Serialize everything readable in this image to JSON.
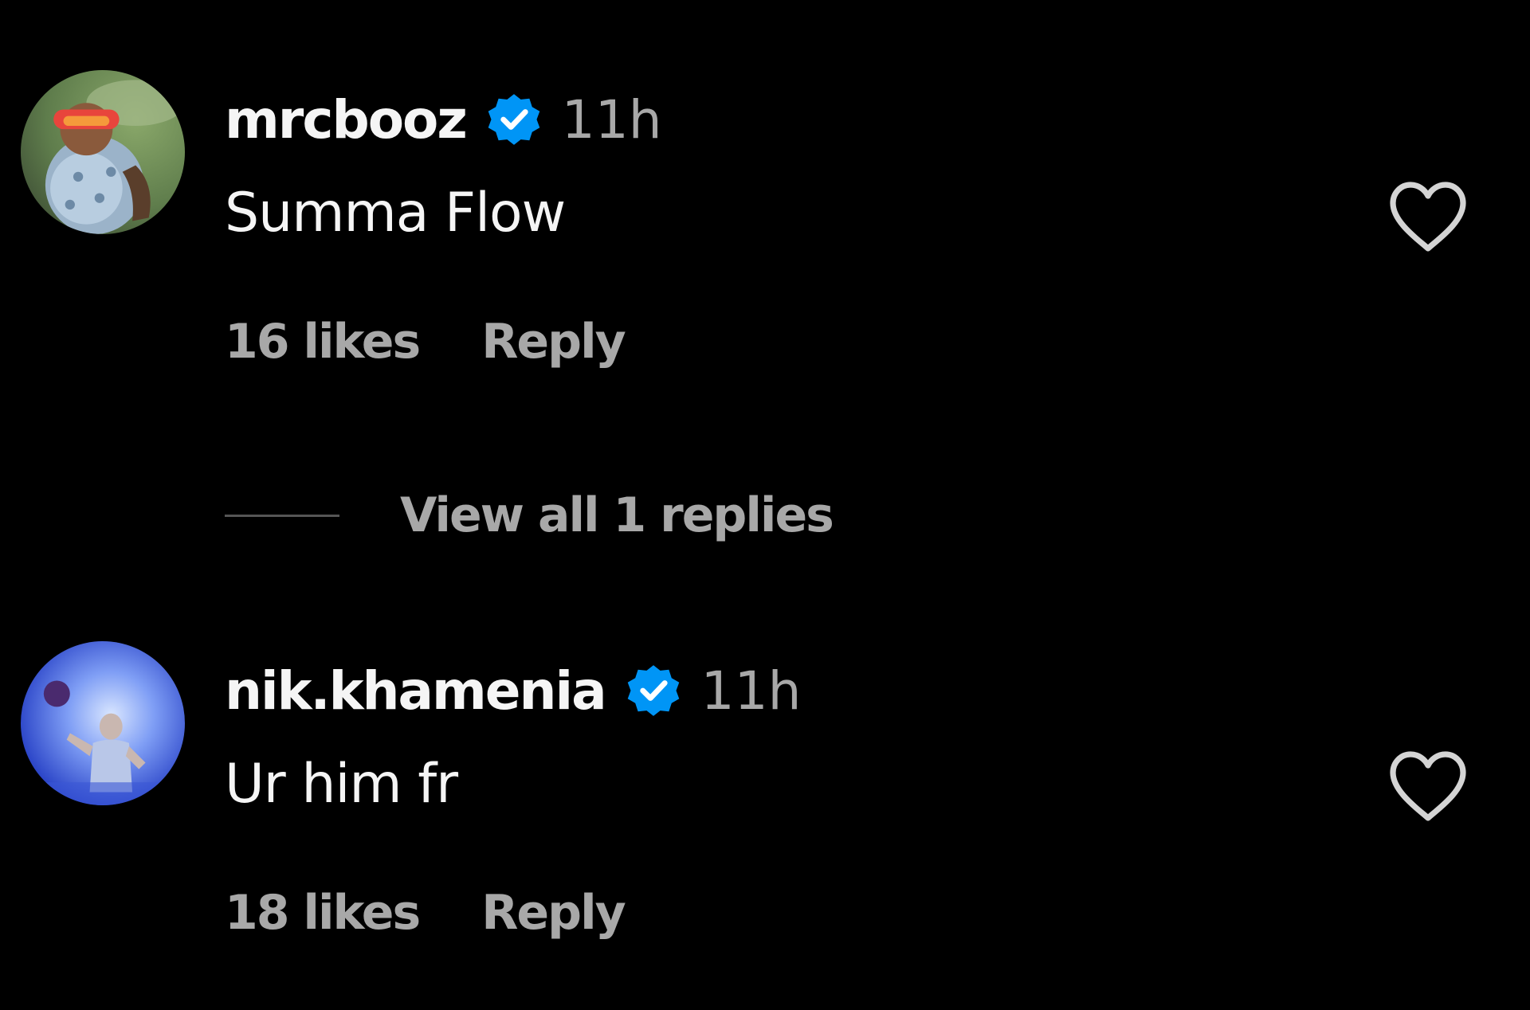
{
  "colors": {
    "background": "#000000",
    "primary_text": "#f5f5f5",
    "secondary_text": "#a8a8a8",
    "verified_blue": "#0095f6",
    "divider": "#555555"
  },
  "comments": [
    {
      "username": "mrcbooz",
      "verified": true,
      "verified_icon": "verified-badge-icon",
      "time": "11h",
      "text": "Summa Flow",
      "likes": "16 likes",
      "reply_label": "Reply",
      "like_icon": "heart-outline-icon",
      "view_replies_label": "View all 1 replies"
    },
    {
      "username": "nik.khamenia",
      "verified": true,
      "verified_icon": "verified-badge-icon",
      "time": "11h",
      "text": "Ur him fr",
      "likes": "18 likes",
      "reply_label": "Reply",
      "like_icon": "heart-outline-icon"
    }
  ]
}
